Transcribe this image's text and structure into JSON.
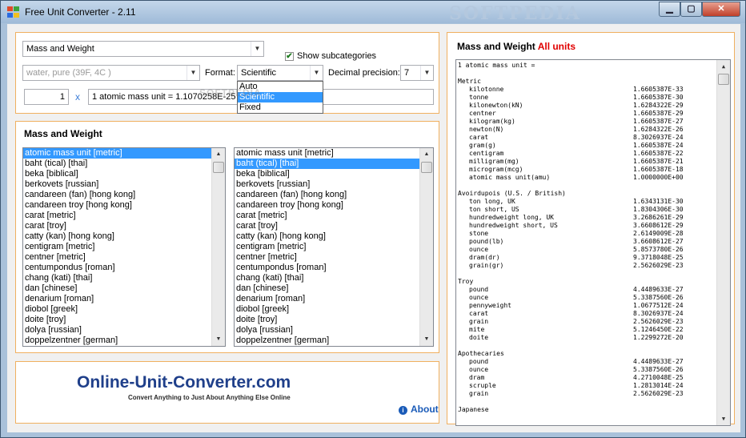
{
  "window": {
    "title": "Free Unit Converter - 2.11",
    "watermark": "SOFTPEDIA"
  },
  "controls": {
    "category": "Mass and Weight",
    "show_subcategories_label": "Show subcategories",
    "show_subcategories_checked": true,
    "material": "water, pure (39F, 4C )",
    "format_label": "Format:",
    "format_value": "Scientific",
    "format_options": [
      "Auto",
      "Scientific",
      "Fixed"
    ],
    "format_selected_index": 1,
    "precision_label": "Decimal precision:",
    "precision_value": "7",
    "amount": "1",
    "times_symbol": "x",
    "result_text": "1 atomic mass unit = 1.1070258E-25 b",
    "dropdown_watermark": "SOFTPEDIA"
  },
  "lists": {
    "header": "Mass and Weight",
    "items": [
      "atomic mass unit [metric]",
      "baht (tical) [thai]",
      "beka [biblical]",
      "berkovets [russian]",
      "candareen (fan) [hong kong]",
      "candareen troy [hong kong]",
      "carat [metric]",
      "carat [troy]",
      "catty (kan) [hong kong]",
      "centigram [metric]",
      "centner [metric]",
      "centumpondus [roman]",
      "chang (kati) [thai]",
      "dan [chinese]",
      "denarium [roman]",
      "diobol [greek]",
      "doite [troy]",
      "dolya [russian]",
      "doppelzentner [german]"
    ],
    "left_selected_index": 0,
    "right_selected_index": 1
  },
  "footer": {
    "logo_text": "Online-Unit-Converter.com",
    "logo_tagline": "Convert Anything to Just About Anything Else Online",
    "about_label": "About"
  },
  "results": {
    "header_prefix": "Mass and Weight",
    "header_highlight": "All units",
    "highlight_color": "#e00000",
    "first_line": "1 atomic mass unit =",
    "groups": [
      {
        "name": "Metric",
        "rows": [
          {
            "n": "kilotonne",
            "v": "1.6605387E-33"
          },
          {
            "n": "tonne",
            "v": "1.6605387E-30"
          },
          {
            "n": "kilonewton(kN)",
            "v": "1.6284322E-29"
          },
          {
            "n": "centner",
            "v": "1.6605387E-29"
          },
          {
            "n": "kilogram(kg)",
            "v": "1.6605387E-27"
          },
          {
            "n": "newton(N)",
            "v": "1.6284322E-26"
          },
          {
            "n": "carat",
            "v": "8.3026937E-24"
          },
          {
            "n": "gram(g)",
            "v": "1.6605387E-24"
          },
          {
            "n": "centigram",
            "v": "1.6605387E-22"
          },
          {
            "n": "milligram(mg)",
            "v": "1.6605387E-21"
          },
          {
            "n": "microgram(mcg)",
            "v": "1.6605387E-18"
          },
          {
            "n": "atomic mass unit(amu)",
            "v": "1.0000000E+00"
          }
        ]
      },
      {
        "name": "Avoirdupois (U.S. / British)",
        "rows": [
          {
            "n": "ton long, UK",
            "v": "1.6343131E-30"
          },
          {
            "n": "ton short, US",
            "v": "1.8304306E-30"
          },
          {
            "n": "hundredweight long, UK",
            "v": "3.2686261E-29"
          },
          {
            "n": "hundredweight short, US",
            "v": "3.6608612E-29"
          },
          {
            "n": "stone",
            "v": "2.6149009E-28"
          },
          {
            "n": "pound(lb)",
            "v": "3.6608612E-27"
          },
          {
            "n": "ounce",
            "v": "5.8573780E-26"
          },
          {
            "n": "dram(dr)",
            "v": "9.3718048E-25"
          },
          {
            "n": "grain(gr)",
            "v": "2.5626029E-23"
          }
        ]
      },
      {
        "name": "Troy",
        "rows": [
          {
            "n": "pound",
            "v": "4.4489633E-27"
          },
          {
            "n": "ounce",
            "v": "5.3387560E-26"
          },
          {
            "n": "pennyweight",
            "v": "1.0677512E-24"
          },
          {
            "n": "carat",
            "v": "8.3026937E-24"
          },
          {
            "n": "grain",
            "v": "2.5626029E-23"
          },
          {
            "n": "mite",
            "v": "5.1246450E-22"
          },
          {
            "n": "doite",
            "v": "1.2299272E-20"
          }
        ]
      },
      {
        "name": "Apothecaries",
        "rows": [
          {
            "n": "pound",
            "v": "4.4489633E-27"
          },
          {
            "n": "ounce",
            "v": "5.3387560E-26"
          },
          {
            "n": "dram",
            "v": "4.2710048E-25"
          },
          {
            "n": "scruple",
            "v": "1.2813014E-24"
          },
          {
            "n": "grain",
            "v": "2.5626029E-23"
          }
        ]
      },
      {
        "name": "Japanese",
        "rows": []
      }
    ]
  }
}
